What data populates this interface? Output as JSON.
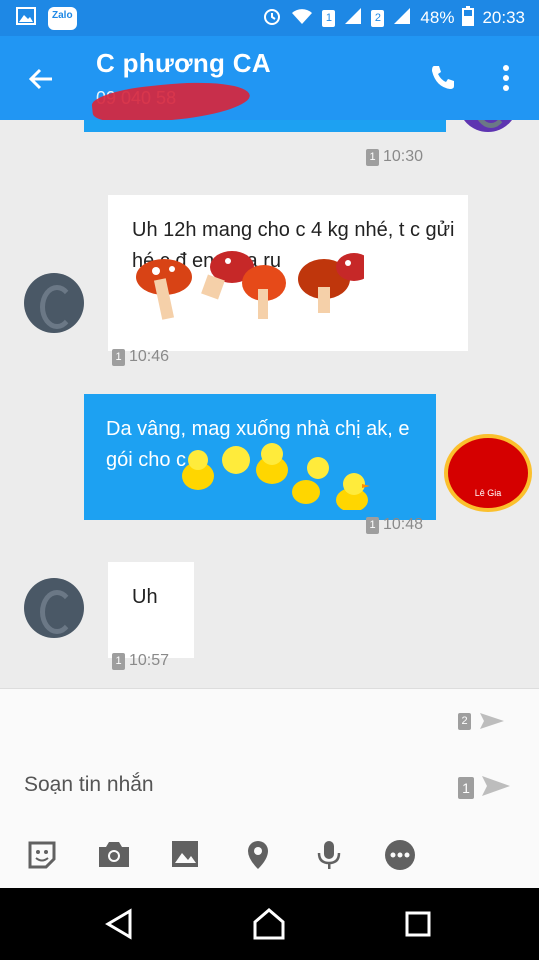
{
  "status_bar": {
    "battery": "48%",
    "time": "20:33",
    "sim1": "1",
    "sim2": "2",
    "app_icon_label": "Zalo"
  },
  "header": {
    "contact_name": "C phương CA",
    "phone_partial": "09 040       58"
  },
  "messages": [
    {
      "direction": "out",
      "text": "",
      "time": "10:30",
      "sim": "1"
    },
    {
      "direction": "in",
      "text": "Uh 12h mang cho c 4 kg nhé, t     c gửi     hé c đ    en c     ha ru",
      "time": "10:46",
      "sim": "1"
    },
    {
      "direction": "out",
      "text": "Da vâng, mag xuống nhà chị ak, e gói cho c       ạ",
      "time": "10:48",
      "sim": "1",
      "sticker_label": "Lê Gia"
    },
    {
      "direction": "in",
      "text": "Uh",
      "time": "10:57",
      "sim": "1"
    }
  ],
  "composer": {
    "placeholder": "Soạn tin nhắn",
    "send_sim1": "1",
    "send_sim2": "2"
  },
  "colors": {
    "primary": "#2196f3",
    "status": "#1e88e5",
    "outgoing_bubble": "#1da1f2",
    "incoming_bubble": "#ffffff",
    "chat_background": "#ececec"
  }
}
